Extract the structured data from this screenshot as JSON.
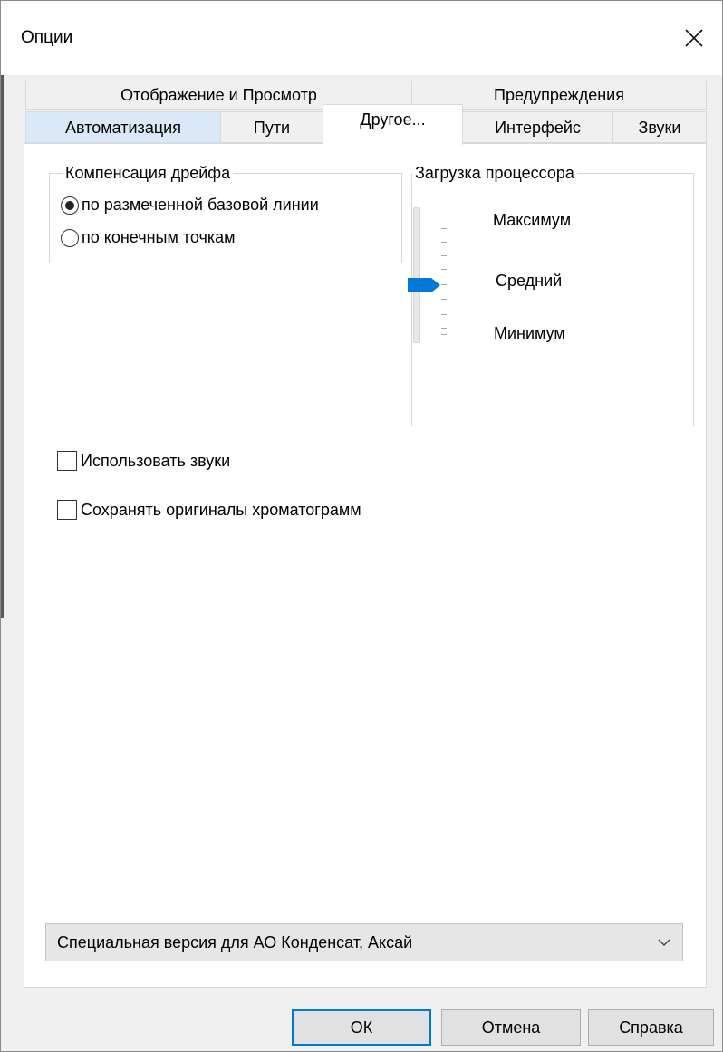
{
  "window": {
    "title": "Опции"
  },
  "tabs": {
    "row1": [
      "Отображение и Просмотр",
      "Предупреждения"
    ],
    "row2": [
      "Автоматизация",
      "Пути",
      "Другое...",
      "Интерфейс",
      "Звуки"
    ],
    "active": "Другое..."
  },
  "drift": {
    "legend": "Компенсация дрейфа",
    "options": [
      "по размеченной базовой линии",
      "по конечным точкам"
    ],
    "selected": "по размеченной базовой линии"
  },
  "cpu": {
    "legend": "Загрузка процессора",
    "labels": {
      "max": "Максимум",
      "mid": "Средний",
      "min": "Минимум"
    },
    "level": "Средний"
  },
  "checks": {
    "use_sounds": {
      "label": "Использовать звуки",
      "checked": false
    },
    "save_originals": {
      "label": "Сохранять оригиналы хроматограмм",
      "checked": false
    }
  },
  "edition": {
    "value": "Специальная версия для АО Конденсат, Аксай"
  },
  "buttons": {
    "ok": "ОК",
    "cancel": "Отмена",
    "help": "Справка"
  },
  "colors": {
    "accent": "#0078d7",
    "tab_highlight": "#dae8f7"
  },
  "icons": {
    "close": "close-icon",
    "dropdown": "chevron-down-icon"
  }
}
